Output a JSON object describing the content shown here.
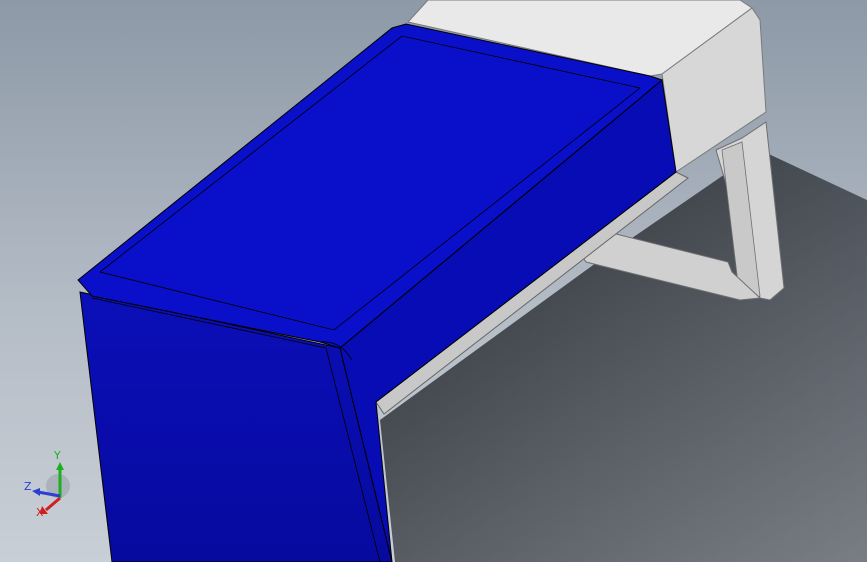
{
  "viewport": {
    "background_top": "#8d99a7",
    "background_bottom": "#c9cfd6"
  },
  "model": {
    "cushion_color": "#0a10c9",
    "frame_color": "#e6e6e6"
  },
  "triad": {
    "y_label": "Y",
    "z_label": "Z",
    "x_label": "X",
    "y_color": "#1fae1f",
    "z_color": "#2b3fd1",
    "x_color": "#d11f1f"
  }
}
